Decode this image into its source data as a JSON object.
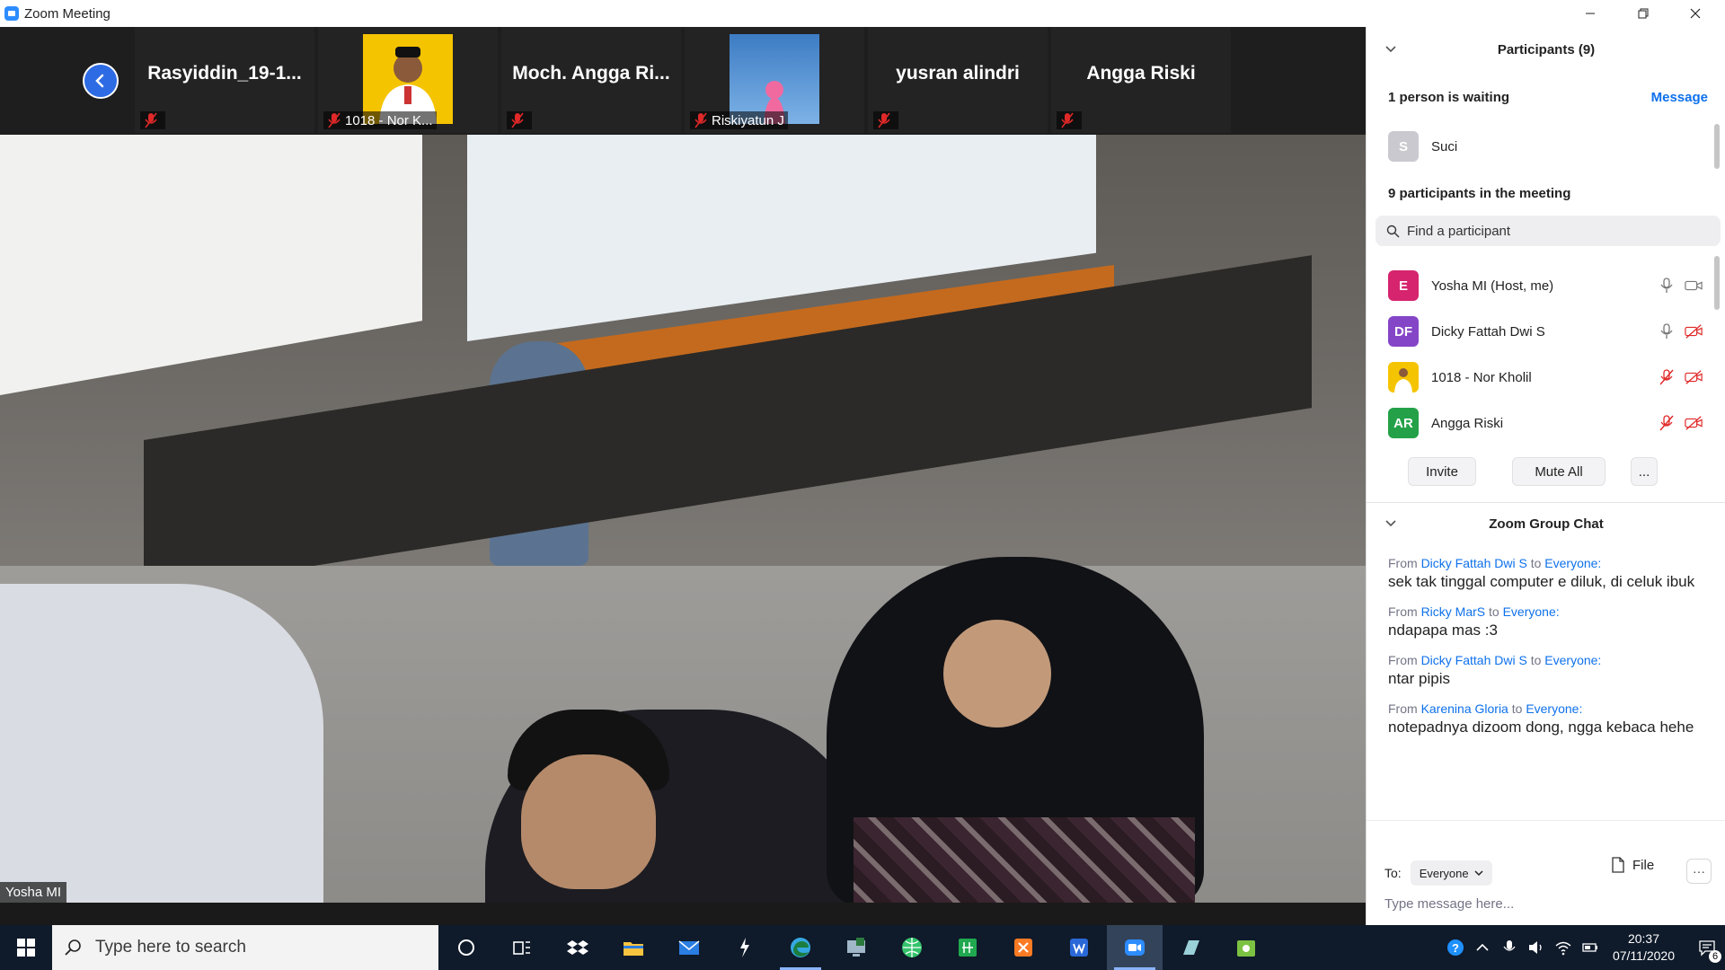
{
  "window": {
    "title": "Zoom Meeting",
    "minimize": "—",
    "restore": "❐",
    "close": "✕"
  },
  "gallery": [
    {
      "name": "Rasyiddin_19-1...",
      "label": "",
      "type": "name"
    },
    {
      "name": "",
      "label": "1018 - Nor K...",
      "type": "photo",
      "color": "#f5c400"
    },
    {
      "name": "Moch. Angga Ri...",
      "label": "",
      "type": "name"
    },
    {
      "name": "",
      "label": "Riskiyatun J",
      "type": "photo",
      "color": "#4a86c8"
    },
    {
      "name": "yusran alindri",
      "label": "",
      "type": "name"
    },
    {
      "name": "Angga Riski",
      "label": "",
      "type": "name"
    }
  ],
  "main_video": {
    "label": "Yosha MI"
  },
  "participants": {
    "header": "Participants (9)",
    "waiting_text": "1 person is waiting",
    "message_label": "Message",
    "waiting": [
      {
        "initial": "S",
        "name": "Suci",
        "color": "#c9c9cf"
      }
    ],
    "meeting_label": "9 participants in the meeting",
    "search_placeholder": "Find a participant",
    "list": [
      {
        "initial": "E",
        "name": "Yosha MI (Host, me)",
        "color": "#d6246e",
        "mic_muted": false,
        "video_off": false
      },
      {
        "initial": "DF",
        "name": "Dicky Fattah Dwi S",
        "color": "#8445c7",
        "mic_muted": false,
        "video_off": true
      },
      {
        "initial": "",
        "name": "1018 - Nor Kholil",
        "color": "#f5c400",
        "mic_muted": true,
        "video_off": true
      },
      {
        "initial": "AR",
        "name": "Angga Riski",
        "color": "#24a148",
        "mic_muted": true,
        "video_off": true
      }
    ],
    "invite_label": "Invite",
    "mute_all_label": "Mute All",
    "more_label": "..."
  },
  "chat": {
    "header": "Zoom Group Chat",
    "messages": [
      {
        "from": "Dicky Fattah Dwi S",
        "to": "Everyone:",
        "text": "sek tak tinggal computer e diluk, di celuk ibuk"
      },
      {
        "from": "Ricky MarS",
        "to": "Everyone:",
        "text": "ndapapa mas :3"
      },
      {
        "from": "Dicky Fattah Dwi S",
        "to": "Everyone:",
        "text": "ntar pipis"
      },
      {
        "from": "Karenina Gloria",
        "to": "Everyone:",
        "text": "notepadnya dizoom dong, ngga kebaca hehe"
      }
    ],
    "from_word": "From",
    "to_word": "to",
    "to_label": "To:",
    "recipient": "Everyone",
    "file_label": "File",
    "more_label": "···",
    "input_placeholder": "Type message here..."
  },
  "taskbar": {
    "search_placeholder": "Type here to search",
    "time": "20:37",
    "date": "07/11/2020",
    "notification_count": "6",
    "apps": [
      {
        "name": "cortana-icon",
        "color": "#ffffff",
        "running": false,
        "active": false
      },
      {
        "name": "task-view-icon",
        "color": "#ffffff",
        "running": false,
        "active": false
      },
      {
        "name": "dropbox-icon",
        "color": "#ffffff",
        "running": false,
        "active": false
      },
      {
        "name": "file-explorer-icon",
        "color": "#f8c440",
        "running": false,
        "active": false
      },
      {
        "name": "mail-icon",
        "color": "#2a7de1",
        "running": false,
        "active": false
      },
      {
        "name": "bolt-app-icon",
        "color": "#ffffff",
        "running": false,
        "active": false
      },
      {
        "name": "edge-icon",
        "color": "#35a8e0",
        "running": true,
        "active": false
      },
      {
        "name": "calculator-monitor-icon",
        "color": "#9fb7c9",
        "running": false,
        "active": false
      },
      {
        "name": "green-globe-icon",
        "color": "#34c36b",
        "running": false,
        "active": false
      },
      {
        "name": "spreadsheet-icon",
        "color": "#1fa84f",
        "running": false,
        "active": false
      },
      {
        "name": "xampp-icon",
        "color": "#fb7a24",
        "running": false,
        "active": false
      },
      {
        "name": "wps-writer-icon",
        "color": "#2a68d8",
        "running": false,
        "active": false
      },
      {
        "name": "zoom-icon",
        "color": "#2d8cff",
        "running": true,
        "active": true
      },
      {
        "name": "whiteboard-app-icon",
        "color": "#9ad0d8",
        "running": false,
        "active": false
      },
      {
        "name": "android-store-icon",
        "color": "#7cc242",
        "running": false,
        "active": false
      }
    ]
  },
  "colors": {
    "accent": "#0e71eb",
    "zoom_blue": "#2d8cff",
    "muted_red": "#e02828"
  }
}
